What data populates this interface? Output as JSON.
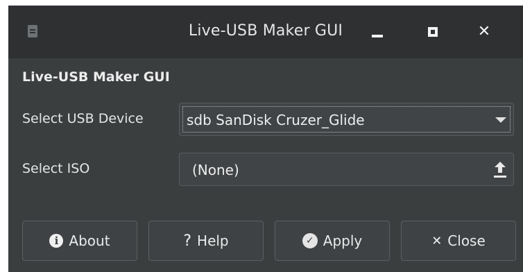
{
  "window": {
    "title": "Live-USB Maker GUI",
    "close_glyph": "✕"
  },
  "main": {
    "heading": "Live-USB Maker GUI",
    "usb_label": "Select USB Device",
    "usb_value": "sdb SanDisk Cruzer_Glide",
    "iso_label": "Select ISO",
    "iso_value": "(None)"
  },
  "buttons": {
    "about": "About",
    "help": "Help",
    "apply": "Apply",
    "close": "Close",
    "about_icon": "i",
    "help_icon": "?",
    "apply_icon": "✓",
    "close_icon": "✕"
  },
  "icons": {
    "app": "app-icon",
    "dropdown": "chevron-down-icon",
    "browse": "upload-icon"
  },
  "colors": {
    "window_bg": "#3b3e3f",
    "titlebar_bg": "#2e3032",
    "text": "#e6e6e6"
  }
}
